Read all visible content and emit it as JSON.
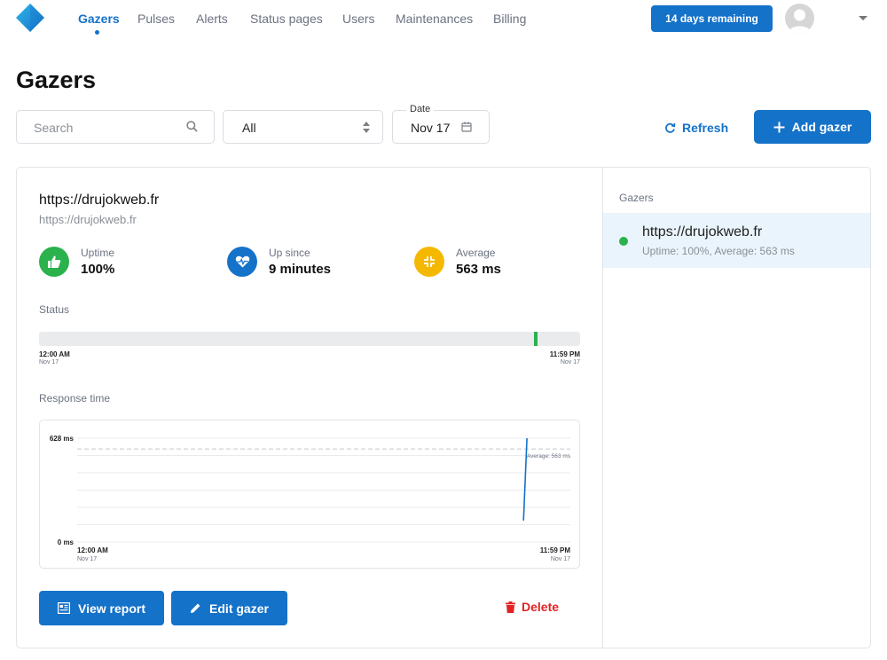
{
  "nav": {
    "items": [
      {
        "label": "Gazers",
        "active": true
      },
      {
        "label": "Pulses"
      },
      {
        "label": "Alerts"
      },
      {
        "label": "Status pages"
      },
      {
        "label": "Users"
      },
      {
        "label": "Maintenances"
      },
      {
        "label": "Billing"
      }
    ],
    "trial_label": "14 days remaining"
  },
  "page_title": "Gazers",
  "filters": {
    "search_placeholder": "Search",
    "status_select": "All",
    "date_label": "Date",
    "date_value": "Nov 17",
    "refresh_label": "Refresh",
    "add_label": "Add gazer"
  },
  "gazer": {
    "title": "https://drujokweb.fr",
    "subtitle": "https://drujokweb.fr",
    "stats": {
      "uptime": {
        "label": "Uptime",
        "value": "100%"
      },
      "up_since": {
        "label": "Up since",
        "value": "9 minutes"
      },
      "average": {
        "label": "Average",
        "value": "563 ms"
      }
    },
    "status": {
      "label": "Status",
      "start_time": "12:00 AM",
      "start_date": "Nov 17",
      "end_time": "11:59 PM",
      "end_date": "Nov 17",
      "up_at_fraction": 0.915
    },
    "response": {
      "label": "Response time"
    },
    "actions": {
      "view_report": "View report",
      "edit": "Edit gazer",
      "delete": "Delete"
    }
  },
  "sidebar": {
    "label": "Gazers",
    "items": [
      {
        "title": "https://drujokweb.fr",
        "subtitle": "Uptime: 100%, Average: 563 ms",
        "status": "up"
      }
    ]
  },
  "colors": {
    "primary": "#1572c9",
    "up": "#2bb24c",
    "uptime_icon": "#2bb24c",
    "upsince_icon": "#1572c9",
    "average_icon": "#f5b800",
    "delete": "#e02424"
  },
  "chart_data": {
    "type": "line",
    "title": "Response time",
    "xlabel": "",
    "ylabel": "",
    "ylim": [
      0,
      628
    ],
    "y_tick_labels": [
      "628 ms",
      "0 ms"
    ],
    "x_tick_labels": [
      {
        "time": "12:00 AM",
        "date": "Nov 17"
      },
      {
        "time": "11:59 PM",
        "date": "Nov 17"
      }
    ],
    "x_domain_fraction": [
      0,
      1
    ],
    "series": [
      {
        "points": [
          {
            "x_fraction": 0.905,
            "y": 130
          },
          {
            "x_fraction": 0.912,
            "y": 628
          }
        ]
      }
    ],
    "average": {
      "value": 563,
      "label": "Average: 563 ms"
    },
    "grid": true
  }
}
